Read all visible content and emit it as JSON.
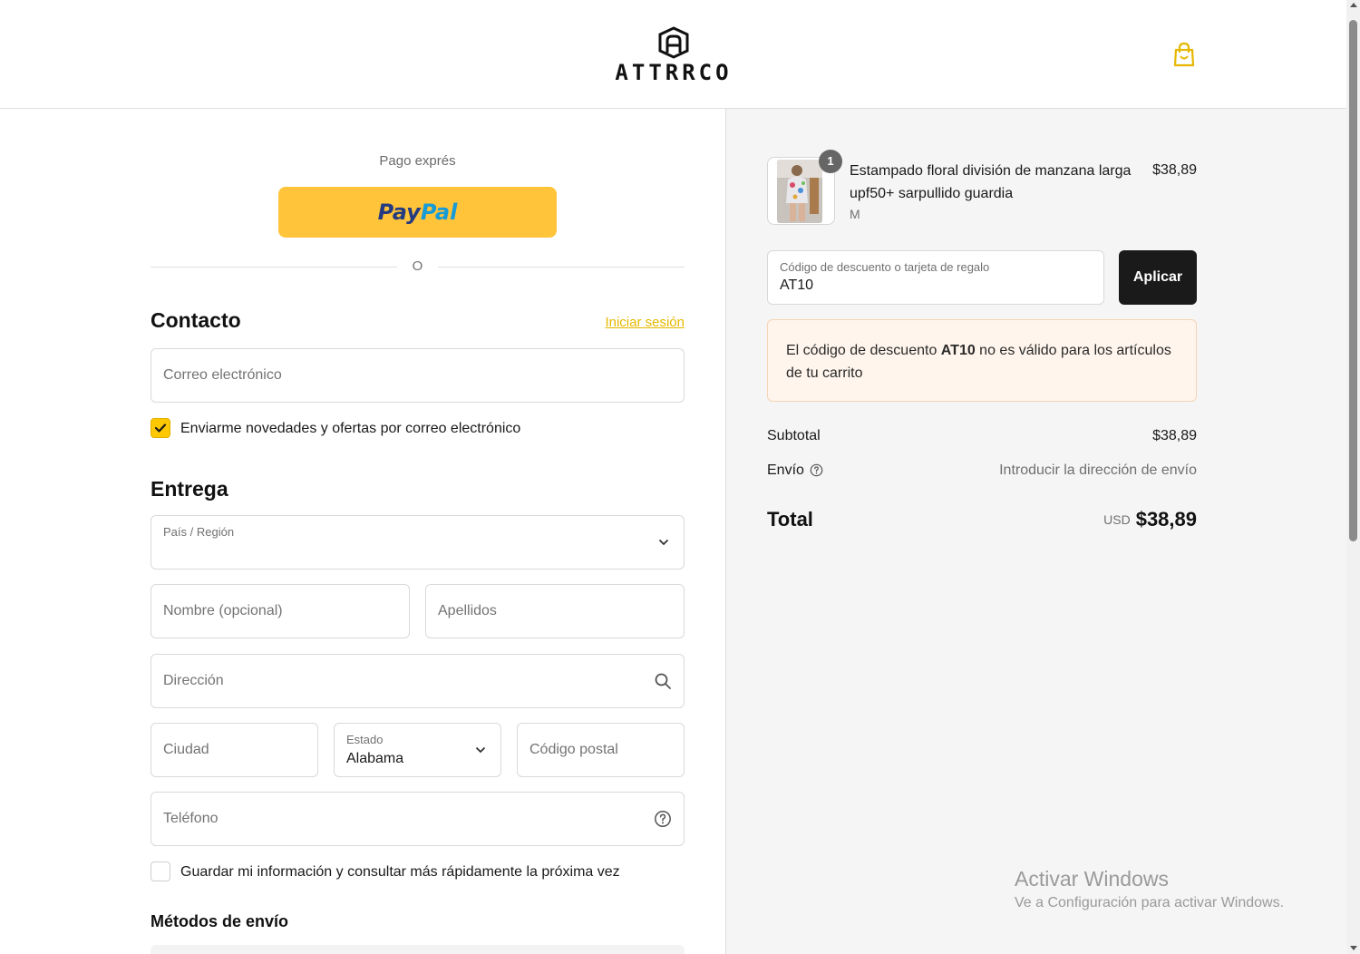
{
  "header": {
    "brand": "ATTRRCO",
    "cart_icon": "shopping-bag-icon"
  },
  "express": {
    "title": "Pago exprés",
    "paypal_part1": "Pay",
    "paypal_part2": "Pal",
    "or": "O"
  },
  "contact": {
    "heading": "Contacto",
    "login_link": "Iniciar sesión",
    "email_placeholder": "Correo electrónico",
    "newsletter_label": "Enviarme novedades y ofertas por correo electrónico",
    "newsletter_checked": true
  },
  "delivery": {
    "heading": "Entrega",
    "country_label": "País / Región",
    "country_value": "",
    "first_name_placeholder": "Nombre (opcional)",
    "last_name_placeholder": "Apellidos",
    "address_placeholder": "Dirección",
    "city_placeholder": "Ciudad",
    "state_label": "Estado",
    "state_value": "Alabama",
    "postal_placeholder": "Código postal",
    "phone_placeholder": "Teléfono",
    "save_info_label": "Guardar mi información y consultar más rápidamente la próxima vez",
    "save_info_checked": false
  },
  "shipping_methods": {
    "heading": "Métodos de envío"
  },
  "summary": {
    "product": {
      "quantity": "1",
      "name": "Estampado floral división de manzana larga upf50+ sarpullido guardia",
      "variant": "M",
      "price": "$38,89"
    },
    "discount": {
      "label": "Código de descuento o tarjeta de regalo",
      "value": "AT10",
      "apply_label": "Aplicar"
    },
    "alert": {
      "prefix": "El código de descuento ",
      "code": "AT10",
      "suffix": " no es válido para los artículos de tu carrito"
    },
    "subtotal_label": "Subtotal",
    "subtotal_value": "$38,89",
    "shipping_label": "Envío",
    "shipping_value": "Introducir la dirección de envío",
    "total_label": "Total",
    "total_currency": "USD",
    "total_value": "$38,89"
  },
  "watermark": {
    "line1": "Activar Windows",
    "line2": "Ve a Configuración para activar Windows."
  },
  "colors": {
    "accent": "#ffc800",
    "paypal": "#ffc439",
    "apply_button": "#1a1a1a",
    "alert_bg": "#fff5ec"
  }
}
